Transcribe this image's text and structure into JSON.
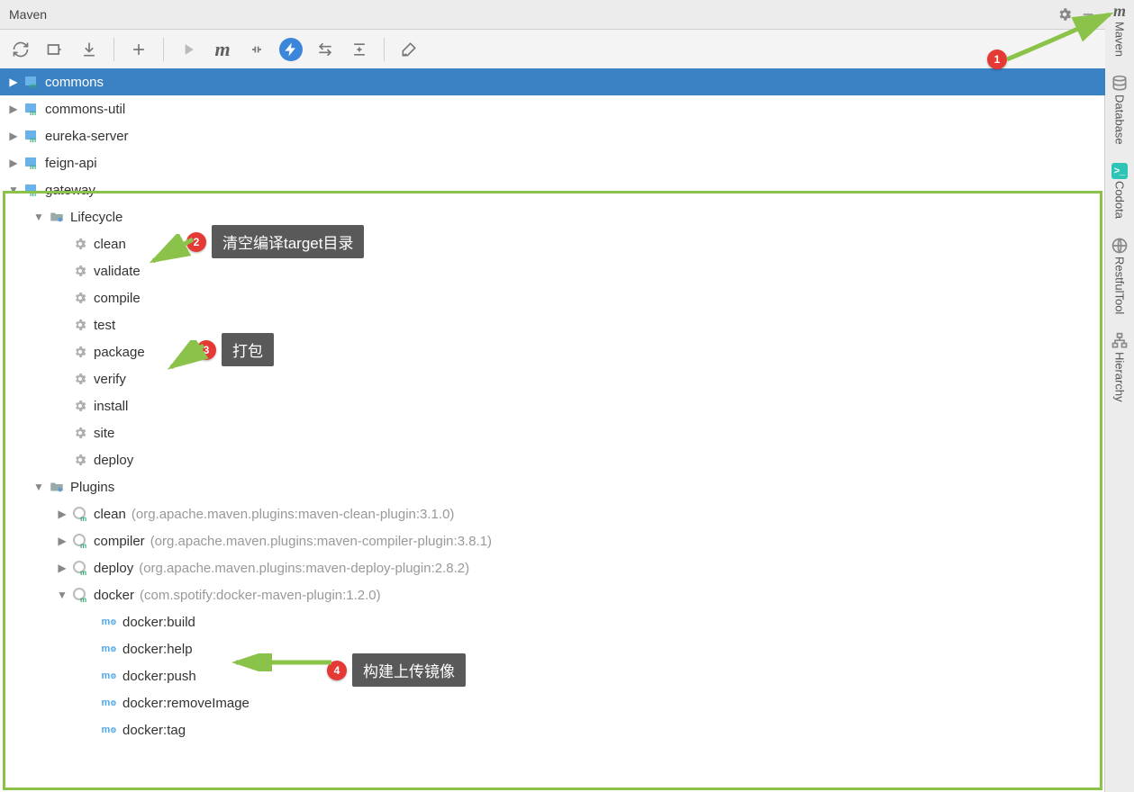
{
  "title": "Maven",
  "right_tabs": [
    {
      "label": "Maven",
      "icon": "m"
    },
    {
      "label": "Database",
      "icon": "db"
    },
    {
      "label": "Codota",
      "icon": "codota"
    },
    {
      "label": "RestfulTool",
      "icon": "rest"
    },
    {
      "label": "Hierarchy",
      "icon": "hier"
    }
  ],
  "projects": [
    {
      "name": "commons",
      "selected": true
    },
    {
      "name": "commons-util"
    },
    {
      "name": "eureka-server"
    },
    {
      "name": "feign-api"
    },
    {
      "name": "gateway",
      "expanded": true
    }
  ],
  "gateway": {
    "lifecycle_label": "Lifecycle",
    "plugins_label": "Plugins",
    "lifecycle": [
      "clean",
      "validate",
      "compile",
      "test",
      "package",
      "verify",
      "install",
      "site",
      "deploy"
    ],
    "plugins": [
      {
        "name": "clean",
        "coords": "(org.apache.maven.plugins:maven-clean-plugin:3.1.0)"
      },
      {
        "name": "compiler",
        "coords": "(org.apache.maven.plugins:maven-compiler-plugin:3.8.1)"
      },
      {
        "name": "deploy",
        "coords": "(org.apache.maven.plugins:maven-deploy-plugin:2.8.2)"
      },
      {
        "name": "docker",
        "coords": "(com.spotify:docker-maven-plugin:1.2.0)",
        "expanded": true
      }
    ],
    "docker_goals": [
      "docker:build",
      "docker:help",
      "docker:push",
      "docker:removeImage",
      "docker:tag"
    ]
  },
  "annotations": {
    "a1": {
      "num": "1"
    },
    "a2": {
      "num": "2",
      "text": "清空编译target目录"
    },
    "a3": {
      "num": "3",
      "text": "打包"
    },
    "a4": {
      "num": "4",
      "text": "构建上传镜像"
    }
  }
}
